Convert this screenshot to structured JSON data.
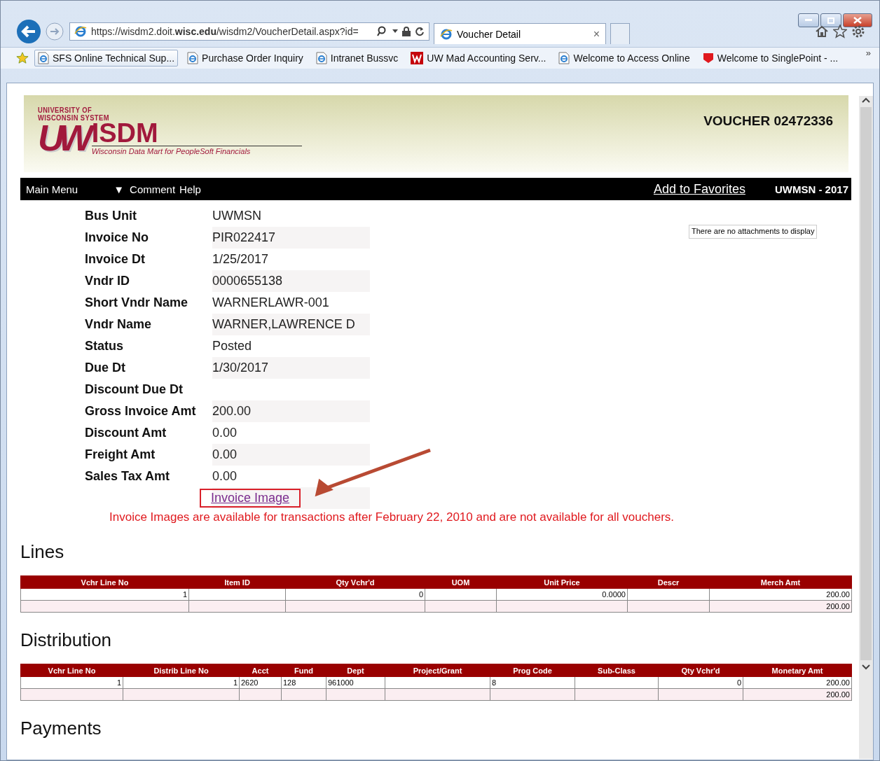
{
  "browser": {
    "address": "https://wisdm2.doit.**wisc.edu**/wisdm2/VoucherDetail.aspx?id=",
    "tabs": [
      {
        "label": "Voucher Detail",
        "selected": true
      }
    ],
    "tab_close": "×",
    "more": "»",
    "favorites": [
      {
        "label": "SFS Online Technical Sup...",
        "kind": "page",
        "selected": true
      },
      {
        "label": "Purchase Order Inquiry",
        "kind": "page",
        "selected": false
      },
      {
        "label": "Intranet Bussvc",
        "kind": "page",
        "selected": false
      },
      {
        "label": "UW Mad Accounting Serv...",
        "kind": "w",
        "selected": false
      },
      {
        "label": "Welcome to Access Online",
        "kind": "page",
        "selected": false
      },
      {
        "label": "Welcome to SinglePoint - ...",
        "kind": "shield",
        "selected": false
      }
    ]
  },
  "header": {
    "logo_line1": "UNIVERSITY OF",
    "logo_line2": "WISCONSIN SYSTEM",
    "logo_mark": "UW",
    "logo_name": "ISDM",
    "tagline": "Wisconsin Data Mart for PeopleSoft Financials",
    "voucher": "VOUCHER 02472336"
  },
  "menu": {
    "items": [
      "Main Menu",
      "Comment",
      "Help"
    ],
    "caret": "▼",
    "favorites_link": "Add to Favorites",
    "unit_year": "UWMSN - 2017"
  },
  "fields": [
    {
      "label": "Bus Unit",
      "value": "UWMSN"
    },
    {
      "label": "Invoice No",
      "value": "PIR022417"
    },
    {
      "label": "Invoice Dt",
      "value": "1/25/2017"
    },
    {
      "label": "Vndr ID",
      "value": "0000655138"
    },
    {
      "label": "Short Vndr Name",
      "value": "WARNERLAWR-001"
    },
    {
      "label": "Vndr Name",
      "value": "WARNER,LAWRENCE D"
    },
    {
      "label": "Status",
      "value": "Posted"
    },
    {
      "label": "Due Dt",
      "value": "1/30/2017"
    },
    {
      "label": "Discount Due Dt"
    },
    {
      "label": "Gross Invoice Amt",
      "value": "200.00"
    },
    {
      "label": "Discount Amt",
      "value": "0.00"
    },
    {
      "label": "Freight Amt",
      "value": "0.00"
    },
    {
      "label": "Sales Tax Amt",
      "value": "0.00"
    }
  ],
  "attachments_note": "There are no attachments to display",
  "invoice_image_link": "Invoice Image",
  "invoice_note": "Invoice Images are available for transactions after February 22, 2010 and are not available for all vouchers.",
  "sections": [
    {
      "title": "Lines",
      "table": {
        "columns": [
          "Vchr Line No",
          "Item ID",
          "Qty Vchr'd",
          "UOM",
          "Unit Price",
          "Descr",
          "Merch Amt"
        ],
        "rows": [
          [
            "1",
            "",
            "0",
            "",
            "0.0000",
            "",
            "200.00"
          ],
          [
            "",
            "",
            "",
            "",
            "",
            "",
            "200.00"
          ]
        ]
      }
    },
    {
      "title": "Distribution",
      "table": {
        "columns": [
          "Vchr Line No",
          "Distrib Line No",
          "Acct",
          "Fund",
          "Dept",
          "Project/Grant",
          "Prog Code",
          "Sub-Class",
          "Qty Vchr'd",
          "Monetary Amt"
        ],
        "rows": [
          [
            "1",
            "1",
            "2620",
            "128",
            "961000",
            "",
            "8",
            "",
            "0",
            "200.00"
          ],
          [
            "",
            "",
            "",
            "",
            "",
            "",
            "",
            "",
            "",
            "200.00"
          ]
        ]
      }
    },
    {
      "title": "Payments"
    }
  ]
}
